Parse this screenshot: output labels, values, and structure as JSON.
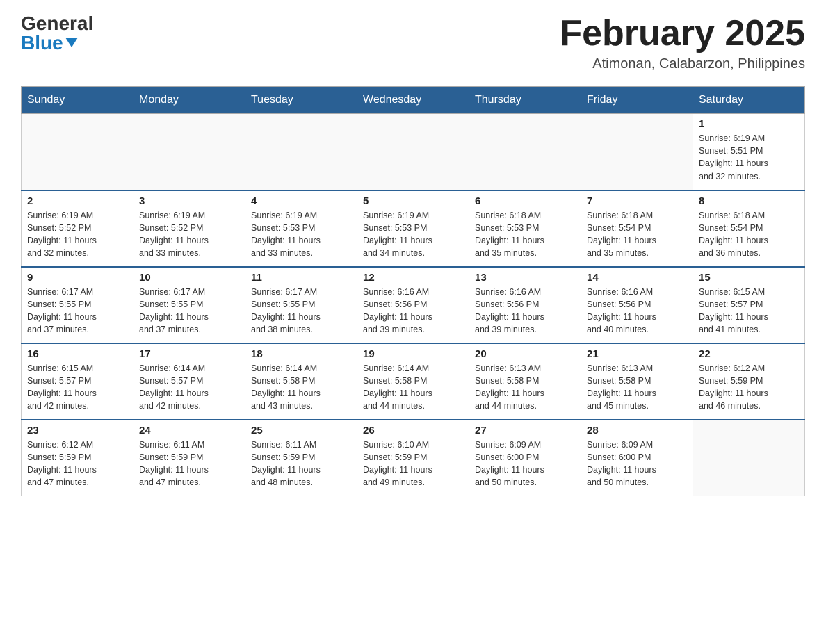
{
  "header": {
    "logo": {
      "general": "General",
      "blue": "Blue",
      "triangle": "▲"
    },
    "title": "February 2025",
    "location": "Atimonan, Calabarzon, Philippines"
  },
  "days_of_week": [
    "Sunday",
    "Monday",
    "Tuesday",
    "Wednesday",
    "Thursday",
    "Friday",
    "Saturday"
  ],
  "weeks": [
    {
      "days": [
        {
          "date": "",
          "info": ""
        },
        {
          "date": "",
          "info": ""
        },
        {
          "date": "",
          "info": ""
        },
        {
          "date": "",
          "info": ""
        },
        {
          "date": "",
          "info": ""
        },
        {
          "date": "",
          "info": ""
        },
        {
          "date": "1",
          "info": "Sunrise: 6:19 AM\nSunset: 5:51 PM\nDaylight: 11 hours\nand 32 minutes."
        }
      ]
    },
    {
      "days": [
        {
          "date": "2",
          "info": "Sunrise: 6:19 AM\nSunset: 5:52 PM\nDaylight: 11 hours\nand 32 minutes."
        },
        {
          "date": "3",
          "info": "Sunrise: 6:19 AM\nSunset: 5:52 PM\nDaylight: 11 hours\nand 33 minutes."
        },
        {
          "date": "4",
          "info": "Sunrise: 6:19 AM\nSunset: 5:53 PM\nDaylight: 11 hours\nand 33 minutes."
        },
        {
          "date": "5",
          "info": "Sunrise: 6:19 AM\nSunset: 5:53 PM\nDaylight: 11 hours\nand 34 minutes."
        },
        {
          "date": "6",
          "info": "Sunrise: 6:18 AM\nSunset: 5:53 PM\nDaylight: 11 hours\nand 35 minutes."
        },
        {
          "date": "7",
          "info": "Sunrise: 6:18 AM\nSunset: 5:54 PM\nDaylight: 11 hours\nand 35 minutes."
        },
        {
          "date": "8",
          "info": "Sunrise: 6:18 AM\nSunset: 5:54 PM\nDaylight: 11 hours\nand 36 minutes."
        }
      ]
    },
    {
      "days": [
        {
          "date": "9",
          "info": "Sunrise: 6:17 AM\nSunset: 5:55 PM\nDaylight: 11 hours\nand 37 minutes."
        },
        {
          "date": "10",
          "info": "Sunrise: 6:17 AM\nSunset: 5:55 PM\nDaylight: 11 hours\nand 37 minutes."
        },
        {
          "date": "11",
          "info": "Sunrise: 6:17 AM\nSunset: 5:55 PM\nDaylight: 11 hours\nand 38 minutes."
        },
        {
          "date": "12",
          "info": "Sunrise: 6:16 AM\nSunset: 5:56 PM\nDaylight: 11 hours\nand 39 minutes."
        },
        {
          "date": "13",
          "info": "Sunrise: 6:16 AM\nSunset: 5:56 PM\nDaylight: 11 hours\nand 39 minutes."
        },
        {
          "date": "14",
          "info": "Sunrise: 6:16 AM\nSunset: 5:56 PM\nDaylight: 11 hours\nand 40 minutes."
        },
        {
          "date": "15",
          "info": "Sunrise: 6:15 AM\nSunset: 5:57 PM\nDaylight: 11 hours\nand 41 minutes."
        }
      ]
    },
    {
      "days": [
        {
          "date": "16",
          "info": "Sunrise: 6:15 AM\nSunset: 5:57 PM\nDaylight: 11 hours\nand 42 minutes."
        },
        {
          "date": "17",
          "info": "Sunrise: 6:14 AM\nSunset: 5:57 PM\nDaylight: 11 hours\nand 42 minutes."
        },
        {
          "date": "18",
          "info": "Sunrise: 6:14 AM\nSunset: 5:58 PM\nDaylight: 11 hours\nand 43 minutes."
        },
        {
          "date": "19",
          "info": "Sunrise: 6:14 AM\nSunset: 5:58 PM\nDaylight: 11 hours\nand 44 minutes."
        },
        {
          "date": "20",
          "info": "Sunrise: 6:13 AM\nSunset: 5:58 PM\nDaylight: 11 hours\nand 44 minutes."
        },
        {
          "date": "21",
          "info": "Sunrise: 6:13 AM\nSunset: 5:58 PM\nDaylight: 11 hours\nand 45 minutes."
        },
        {
          "date": "22",
          "info": "Sunrise: 6:12 AM\nSunset: 5:59 PM\nDaylight: 11 hours\nand 46 minutes."
        }
      ]
    },
    {
      "days": [
        {
          "date": "23",
          "info": "Sunrise: 6:12 AM\nSunset: 5:59 PM\nDaylight: 11 hours\nand 47 minutes."
        },
        {
          "date": "24",
          "info": "Sunrise: 6:11 AM\nSunset: 5:59 PM\nDaylight: 11 hours\nand 47 minutes."
        },
        {
          "date": "25",
          "info": "Sunrise: 6:11 AM\nSunset: 5:59 PM\nDaylight: 11 hours\nand 48 minutes."
        },
        {
          "date": "26",
          "info": "Sunrise: 6:10 AM\nSunset: 5:59 PM\nDaylight: 11 hours\nand 49 minutes."
        },
        {
          "date": "27",
          "info": "Sunrise: 6:09 AM\nSunset: 6:00 PM\nDaylight: 11 hours\nand 50 minutes."
        },
        {
          "date": "28",
          "info": "Sunrise: 6:09 AM\nSunset: 6:00 PM\nDaylight: 11 hours\nand 50 minutes."
        },
        {
          "date": "",
          "info": ""
        }
      ]
    }
  ]
}
